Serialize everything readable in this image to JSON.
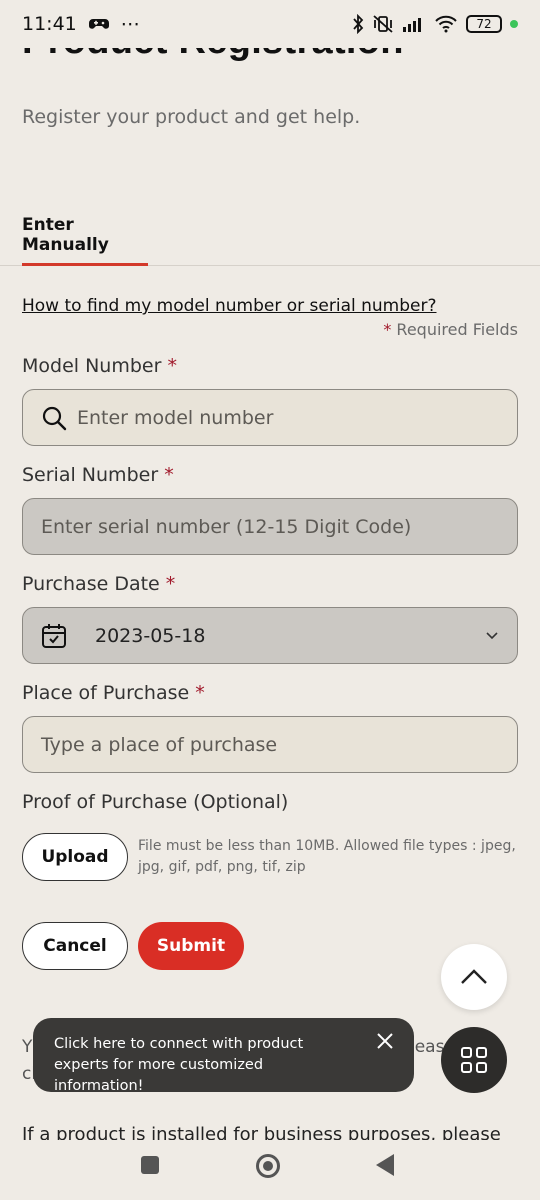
{
  "status_bar": {
    "time": "11:41",
    "more": "⋯",
    "battery": "72"
  },
  "page": {
    "title": "Product Registration",
    "subtitle": "Register your product and get help."
  },
  "tabs": [
    {
      "label": "Enter Manually",
      "active": true
    }
  ],
  "help_link": "How to find my model number or serial number?",
  "required_note": {
    "star": "*",
    "text": " Required Fields"
  },
  "form": {
    "model_number": {
      "label": "Model Number",
      "required": "*",
      "placeholder": "Enter model number"
    },
    "serial_number": {
      "label": "Serial Number",
      "required": "*",
      "placeholder": "Enter serial number (12-15 Digit Code)"
    },
    "purchase_date": {
      "label": "Purchase Date",
      "required": "*",
      "value": "2023-05-18"
    },
    "place_of_purchase": {
      "label": "Place of Purchase",
      "required": "*",
      "placeholder": "Type a place of purchase"
    },
    "proof_of_purchase": {
      "label": "Proof of Purchase (Optional)",
      "upload_label": "Upload",
      "note": "File must be less than 10MB. Allowed file types : jpeg, jpg, gif, pdf, png, tif, zip"
    }
  },
  "actions": {
    "cancel": "Cancel",
    "submit": "Submit"
  },
  "obscured_text": {
    "line1_start": "Y",
    "line1_end": "leas",
    "line2_start": "cl",
    "business_note": "If a product is installed for business purposes, please"
  },
  "toast": {
    "message": "Click here to connect with product experts for more customized information!"
  },
  "colors": {
    "accent": "#d92e25",
    "background": "#efebe5",
    "required_star": "#a11a2c"
  },
  "icons": [
    "search-icon",
    "calendar-icon",
    "chevron-down-icon",
    "close-icon",
    "chevron-up-icon",
    "grid-icon"
  ]
}
